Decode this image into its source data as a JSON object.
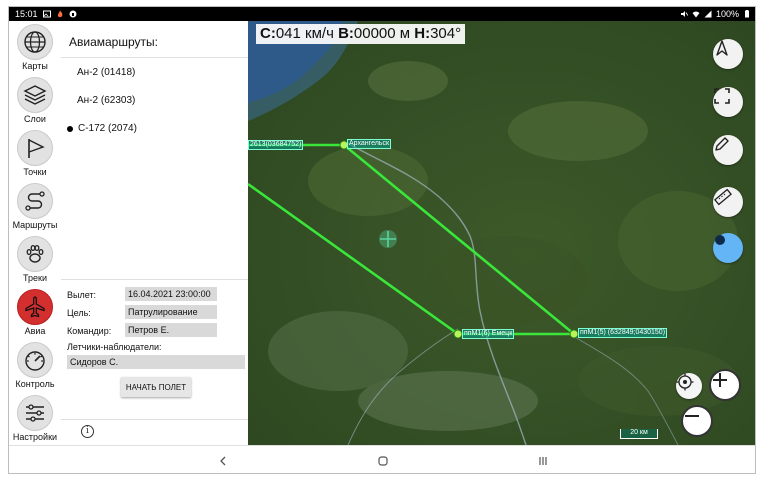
{
  "status_bar": {
    "time": "15:01",
    "battery": "100%",
    "left_icons": [
      "image-icon",
      "fire-icon",
      "vpn-icon"
    ],
    "right_icons": [
      "mute-icon",
      "wifi-icon",
      "signal-icon",
      "battery-icon"
    ]
  },
  "rail": {
    "items": [
      {
        "id": "maps",
        "label": "Карты",
        "icon": "globe-icon"
      },
      {
        "id": "layers",
        "label": "Слои",
        "icon": "layers-icon"
      },
      {
        "id": "points",
        "label": "Точки",
        "icon": "flag-icon"
      },
      {
        "id": "routes",
        "label": "Маршруты",
        "icon": "route-icon"
      },
      {
        "id": "tracks",
        "label": "Треки",
        "icon": "paw-icon"
      },
      {
        "id": "avia",
        "label": "Авиа",
        "icon": "airplane-icon",
        "active": true
      },
      {
        "id": "control",
        "label": "Контроль",
        "icon": "gauge-icon"
      },
      {
        "id": "settings",
        "label": "Настройки",
        "icon": "sliders-icon"
      }
    ]
  },
  "panel": {
    "title": "Авиамаршруты:",
    "routes": [
      {
        "label": "Ан-2 (01418)",
        "selected": false
      },
      {
        "label": "Ан-2 (62303)",
        "selected": false
      },
      {
        "label": "С-172 (2074)",
        "selected": true
      }
    ],
    "form": {
      "departure_label": "Вылет:",
      "departure_value": "16.04.2021 23:00:00",
      "goal_label": "Цель:",
      "goal_value": "Патрулирование",
      "commander_label": "Командир:",
      "commander_value": "Петров Е.",
      "observers_label": "Летчики-наблюдатели:",
      "observers_value": "Сидоров С."
    },
    "start_button": "НАЧАТЬ ПОЛЕТ",
    "info_icon": "info-icon"
  },
  "map": {
    "hud": {
      "speed_label": "С:",
      "speed_value": "041 км/ч",
      "alt_label": "В:",
      "alt_value": "00000 м",
      "heading_label": "Н:",
      "heading_value": "304°"
    },
    "waypoints": [
      {
        "label": "2613(03684752)"
      },
      {
        "label": "Архангельск"
      },
      {
        "label": "ппМ1(6) Емецк"
      },
      {
        "label": "ппМ1(5) (632849;0430150)"
      }
    ],
    "scale": "20 км",
    "route_color": "#39e639",
    "tools": [
      "navigate-icon",
      "fullscreen-icon",
      "pencil-icon",
      "ruler-icon",
      "record-icon"
    ],
    "locate_icon": "crosshair-icon",
    "zoom_in": "+",
    "zoom_out": "−"
  },
  "nav_bar": {
    "back": "‹",
    "home": "○",
    "recents": "|||"
  }
}
